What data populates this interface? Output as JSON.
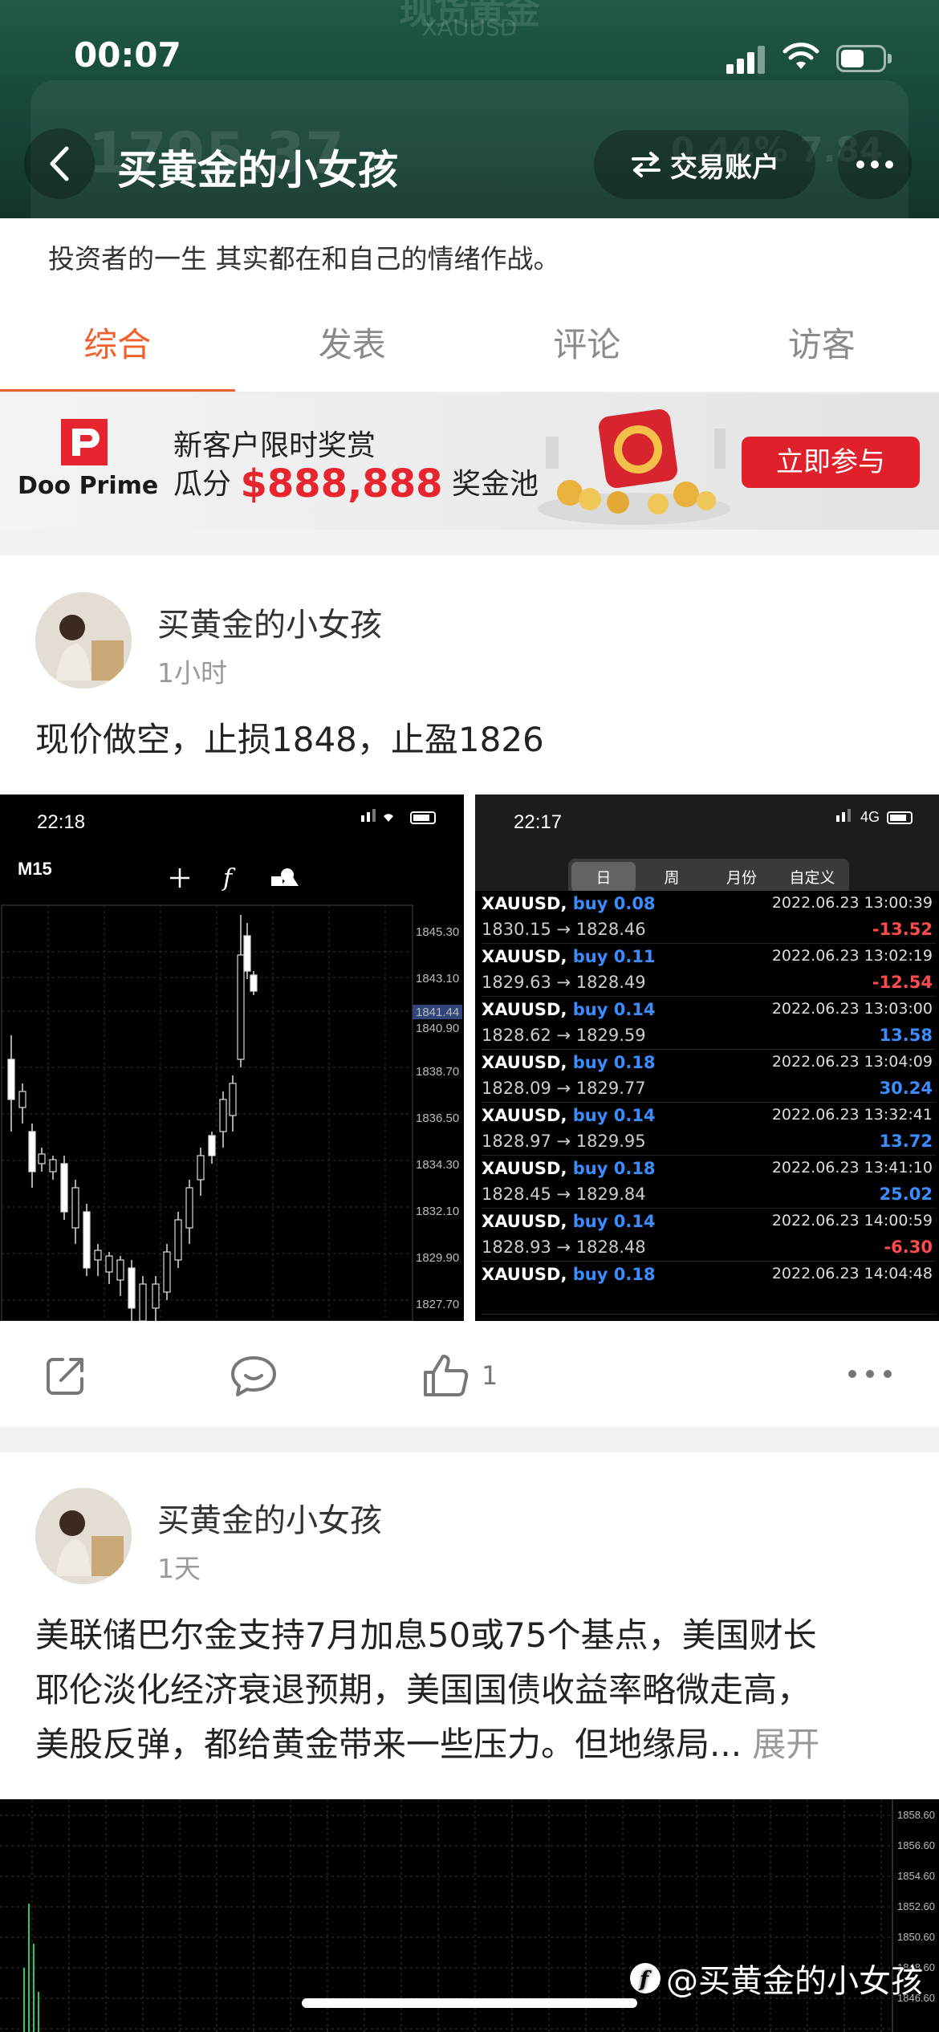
{
  "status_bar": {
    "time": "00:07"
  },
  "header": {
    "ghost_title": "现货黄金",
    "ghost_symbol": "XAUUSD",
    "ghost_price": "1795.37",
    "ghost_change": "0.44%  7.84",
    "title": "买黄金的小女孩",
    "account_button": "交易账户"
  },
  "bio": "投资者的一生 其实都在和自己的情绪作战。",
  "tabs": [
    {
      "label": "综合",
      "active": true
    },
    {
      "label": "发表",
      "active": false
    },
    {
      "label": "评论",
      "active": false
    },
    {
      "label": "访客",
      "active": false
    }
  ],
  "banner": {
    "brand": "Doo Prime",
    "line1": "新客户限时奖赏",
    "line2_prefix": "瓜分",
    "amount": "$888,888",
    "line2_suffix": "奖金池",
    "cta": "立即参与"
  },
  "posts": [
    {
      "author": "买黄金的小女孩",
      "time": "1小时",
      "text": "现价做空，止损1848，止盈1826",
      "chart_shot": {
        "time": "22:18",
        "timeframe": "M15",
        "price_labels": [
          "1845.30",
          "1843.10",
          "1841.44",
          "1840.90",
          "1838.70",
          "1836.50",
          "1834.30",
          "1832.10",
          "1829.90",
          "1827.70"
        ]
      },
      "history_shot": {
        "time": "22:17",
        "network": "4G",
        "segments": [
          "日",
          "周",
          "月份",
          "自定义"
        ],
        "rows": [
          {
            "symbol": "XAUUSD,",
            "side": "buy 0.08",
            "datetime": "2022.06.23 13:00:39",
            "prices": "1830.15 → 1828.46",
            "pl": "-13.52"
          },
          {
            "symbol": "XAUUSD,",
            "side": "buy 0.11",
            "datetime": "2022.06.23 13:02:19",
            "prices": "1829.63 → 1828.49",
            "pl": "-12.54"
          },
          {
            "symbol": "XAUUSD,",
            "side": "buy 0.14",
            "datetime": "2022.06.23 13:03:00",
            "prices": "1828.62 → 1829.59",
            "pl": "13.58"
          },
          {
            "symbol": "XAUUSD,",
            "side": "buy 0.18",
            "datetime": "2022.06.23 13:04:09",
            "prices": "1828.09 → 1829.77",
            "pl": "30.24"
          },
          {
            "symbol": "XAUUSD,",
            "side": "buy 0.14",
            "datetime": "2022.06.23 13:32:41",
            "prices": "1828.97 → 1829.95",
            "pl": "13.72"
          },
          {
            "symbol": "XAUUSD,",
            "side": "buy 0.18",
            "datetime": "2022.06.23 13:41:10",
            "prices": "1828.45 → 1829.84",
            "pl": "25.02"
          },
          {
            "symbol": "XAUUSD,",
            "side": "buy 0.14",
            "datetime": "2022.06.23 14:00:59",
            "prices": "1828.93 → 1828.48",
            "pl": "-6.30"
          },
          {
            "symbol": "XAUUSD,",
            "side": "buy 0.18",
            "datetime": "2022.06.23 14:04:48",
            "prices": "",
            "pl": ""
          }
        ]
      },
      "likes": "1"
    },
    {
      "author": "买黄金的小女孩",
      "time": "1天",
      "text_line1": "美联储巴尔金支持7月加息50或75个基点，美国财长",
      "text_line2": "耶伦淡化经济衰退预期，美国国债收益率略微走高，",
      "text_line3": "美股反弹，都给黄金带来一些压力。但地缘局...",
      "expand": "展开",
      "chart_price_labels": [
        "1858.60",
        "1856.60",
        "1854.60",
        "1852.60",
        "1850.60",
        "1848.60",
        "1846.60"
      ]
    }
  ],
  "watermark": "@买黄金的小女孩"
}
